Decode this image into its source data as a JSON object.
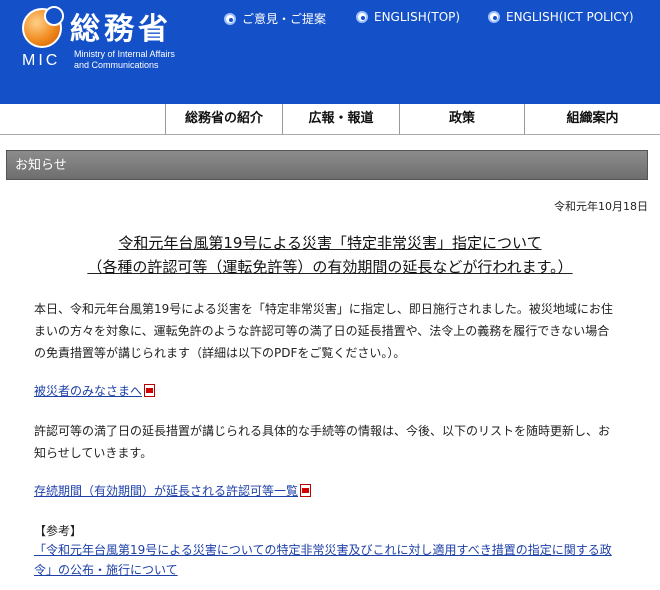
{
  "header": {
    "logo_jp": "総務省",
    "logo_abbr": "MIC",
    "logo_en_line1": "Ministry of Internal Affairs",
    "logo_en_line2": "and Communications",
    "links": [
      "ご意見・ご提案",
      "ENGLISH(TOP)",
      "ENGLISH(ICT POLICY)"
    ]
  },
  "nav": {
    "items": [
      "総務省の紹介",
      "広報・報道",
      "政策",
      "組織案内"
    ]
  },
  "notice": {
    "bar_label": "お知らせ",
    "date": "令和元年10月18日",
    "title_line1": "令和元年台風第19号による災害「特定非常災害」指定について",
    "title_line2": "（各種の許認可等（運転免許等）の有効期間の延長などが行われます。）",
    "para1": "本日、令和元年台風第19号による災害を「特定非常災害」に指定し、即日施行されました。被災地域にお住まいの方々を対象に、運転免許のような許認可等の満了日の延長措置や、法令上の義務を履行できない場合の免責措置等が講じられます（詳細は以下のPDFをご覧ください。）。",
    "link1": "被災者のみなさまへ",
    "para2": "許認可等の満了日の延長措置が講じられる具体的な手続等の情報は、今後、以下のリストを随時更新し、お知らせしていきます。",
    "link2": "存続期間（有効期間）が延長される許認可等一覧",
    "ref_label": "【参考】",
    "ref_link": "「令和元年台風第19号による災害についての特定非常災害及びこれに対し適用すべき措置の指定に関する政令」の公布・施行について"
  },
  "colors": {
    "header_bg": "#1450c8",
    "link": "#1d3fa8",
    "bar": "#7a7a7a"
  }
}
